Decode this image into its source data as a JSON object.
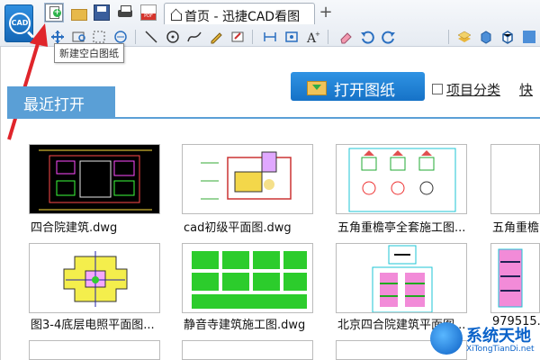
{
  "tab": {
    "label": "首页 - 迅捷CAD看图"
  },
  "tooltip": {
    "text": "新建空白图纸"
  },
  "main": {
    "open_drawing_label": "打开图纸",
    "category_label": "项目分类",
    "quick_label": "快",
    "recent_label": "最近打开"
  },
  "files": [
    {
      "name": "四合院建筑.dwg"
    },
    {
      "name": "cad初级平面图.dwg"
    },
    {
      "name": "五角重檐亭全套施工图..."
    },
    {
      "name": "五角重檐"
    },
    {
      "name": "图3-4底层电照平面图..."
    },
    {
      "name": "静音寺建筑施工图.dwg"
    },
    {
      "name": "北京四合院建筑平面图..."
    },
    {
      "name": "979515..."
    }
  ],
  "watermark": {
    "title": "系统天地",
    "url": "XiTongTianDi.net"
  },
  "colors": {
    "accent": "#1672c7",
    "recent_tab": "#5a9fd6"
  }
}
